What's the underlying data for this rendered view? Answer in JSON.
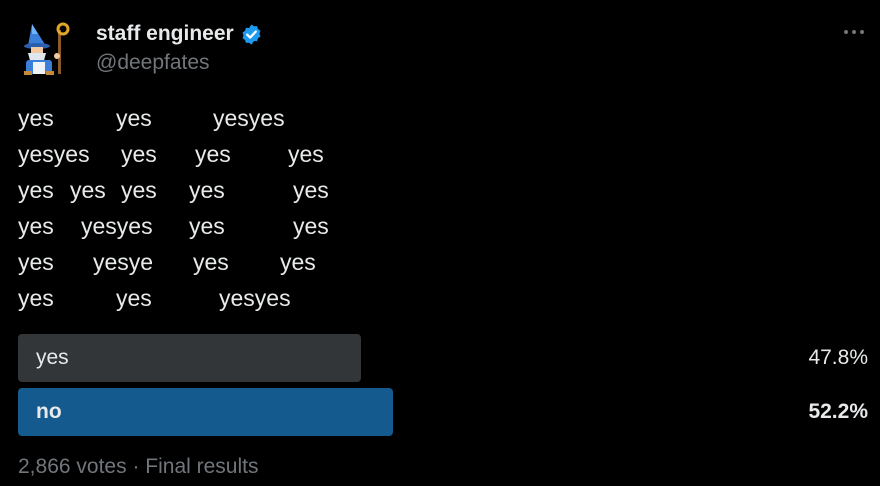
{
  "author": {
    "display_name": "staff engineer",
    "handle": "@deepfates",
    "verified": true,
    "verified_icon": "verified-badge-icon",
    "avatar": "wizard-avatar"
  },
  "menu": {
    "icon": "more-horizontal-icon"
  },
  "tweet": {
    "lines": [
      [
        "yes",
        "yes",
        "yesyes"
      ],
      [
        "yesyes",
        "yes",
        "yes",
        "yes"
      ],
      [
        "yes",
        "yes",
        "yes",
        "yes",
        "yes"
      ],
      [
        "yes",
        "yesyes",
        "yes",
        "yes"
      ],
      [
        "yes",
        "yesye",
        "yes",
        "yes"
      ],
      [
        "yes",
        "yes",
        "yesyes"
      ]
    ]
  },
  "poll": {
    "options": [
      {
        "label": "yes",
        "percent": "47.8%",
        "share": 0.478,
        "winner": false
      },
      {
        "label": "no",
        "percent": "52.2%",
        "share": 0.522,
        "winner": true
      }
    ],
    "votes": "2,866 votes",
    "separator": "·",
    "status": "Final results"
  },
  "colors": {
    "background": "#000000",
    "text": "#e7e9ea",
    "muted": "#71767b",
    "bar_default": "#333639",
    "bar_winner": "#145a8e",
    "verified": "#1d9bf0"
  }
}
